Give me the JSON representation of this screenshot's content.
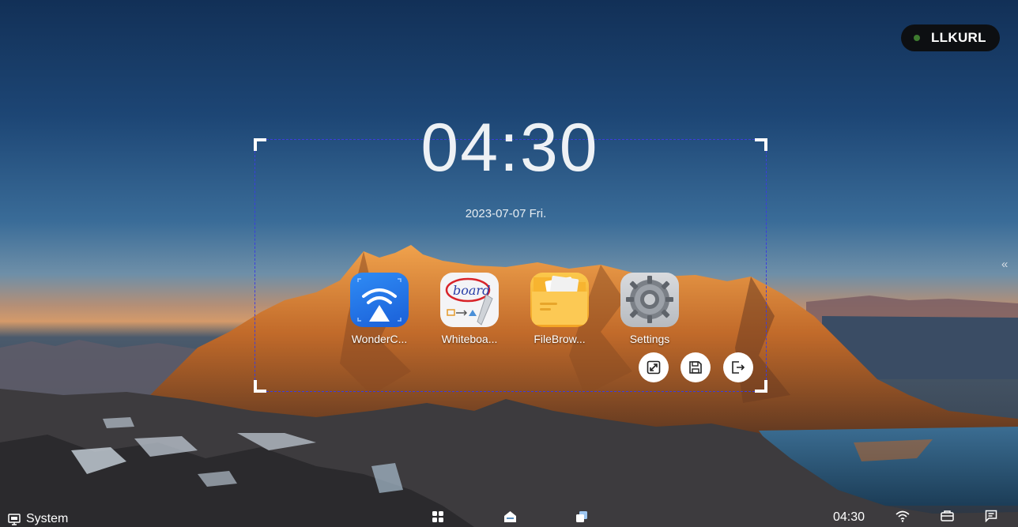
{
  "status": {
    "user_label": "LLKURL"
  },
  "clock": {
    "time": "04:30",
    "date": "2023-07-07  Fri."
  },
  "apps": [
    {
      "label": "WonderC...",
      "icon": "wireless-cast-icon"
    },
    {
      "label": "Whiteboa...",
      "icon": "whiteboard-icon"
    },
    {
      "label": "FileBrow...",
      "icon": "folder-icon"
    },
    {
      "label": "Settings",
      "icon": "gear-icon"
    }
  ],
  "board_logo_text": "board",
  "selection_actions": [
    "expand-icon",
    "save-icon",
    "exit-icon"
  ],
  "taskbar": {
    "system_label": "System",
    "time": "04:30",
    "center_icons": [
      "apps-grid-icon",
      "home-icon",
      "multitask-icon"
    ],
    "tray_icons": [
      "wifi-icon",
      "toolbox-icon",
      "message-icon"
    ]
  },
  "side_handle": "«",
  "colors": {
    "selection_border": "#3b3ddf",
    "pill_dot": "#3e7b2f",
    "pill_bg": "#0d0f12"
  }
}
